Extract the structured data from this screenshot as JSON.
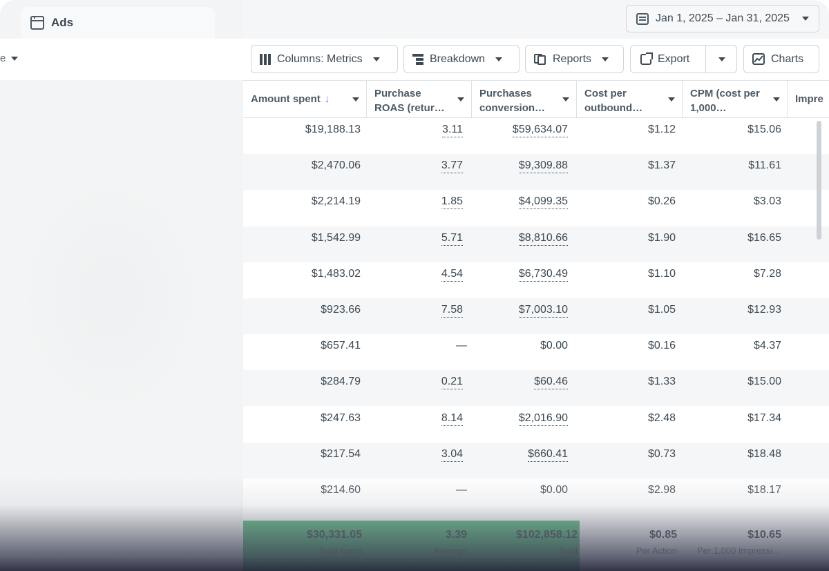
{
  "tab": {
    "label": "Ads"
  },
  "left_dropdown": {
    "label": "e"
  },
  "date_range": {
    "label": "Jan 1, 2025 – Jan 31, 2025"
  },
  "toolbar": {
    "columns": "Columns: Metrics",
    "breakdown": "Breakdown",
    "reports": "Reports",
    "export": "Export",
    "charts": "Charts"
  },
  "table": {
    "headers": [
      {
        "line1": "Amount spent",
        "line2": "",
        "sort_arrow": "↓"
      },
      {
        "line1": "Purchase",
        "line2": "ROAS (retur…"
      },
      {
        "line1": "Purchases",
        "line2": "conversion…"
      },
      {
        "line1": "Cost per",
        "line2": "outbound…"
      },
      {
        "line1": "CPM (cost per",
        "line2": "1,000…"
      },
      {
        "line1": "Impre",
        "line2": ""
      }
    ],
    "rows": [
      [
        "$19,188.13",
        "3.11",
        "$59,634.07",
        "$1.12",
        "$15.06"
      ],
      [
        "$2,470.06",
        "3.77",
        "$9,309.88",
        "$1.37",
        "$11.61"
      ],
      [
        "$2,214.19",
        "1.85",
        "$4,099.35",
        "$0.26",
        "$3.03"
      ],
      [
        "$1,542.99",
        "5.71",
        "$8,810.66",
        "$1.90",
        "$16.65"
      ],
      [
        "$1,483.02",
        "4.54",
        "$6,730.49",
        "$1.10",
        "$7.28"
      ],
      [
        "$923.66",
        "7.58",
        "$7,003.10",
        "$1.05",
        "$12.93"
      ],
      [
        "$657.41",
        "—",
        "$0.00",
        "$0.16",
        "$4.37"
      ],
      [
        "$284.79",
        "0.21",
        "$60.46",
        "$1.33",
        "$15.00"
      ],
      [
        "$247.63",
        "8.14",
        "$2,016.90",
        "$2.48",
        "$17.34"
      ],
      [
        "$217.54",
        "3.04",
        "$660.41",
        "$0.73",
        "$18.48"
      ],
      [
        "$214.60",
        "—",
        "$0.00",
        "$2.98",
        "$18.17"
      ]
    ],
    "totals": [
      {
        "value": "$30,331.05",
        "label": "Total spent"
      },
      {
        "value": "3.39",
        "label": "Average"
      },
      {
        "value": "$102,858.12",
        "label": "Total"
      },
      {
        "value": "$0.85",
        "label": "Per Action"
      },
      {
        "value": "$10.65",
        "label": "Per 1,000 Impressi…"
      }
    ]
  },
  "colors": {
    "accent_blue": "#4a83e8",
    "totals_green": "#3fb068"
  }
}
